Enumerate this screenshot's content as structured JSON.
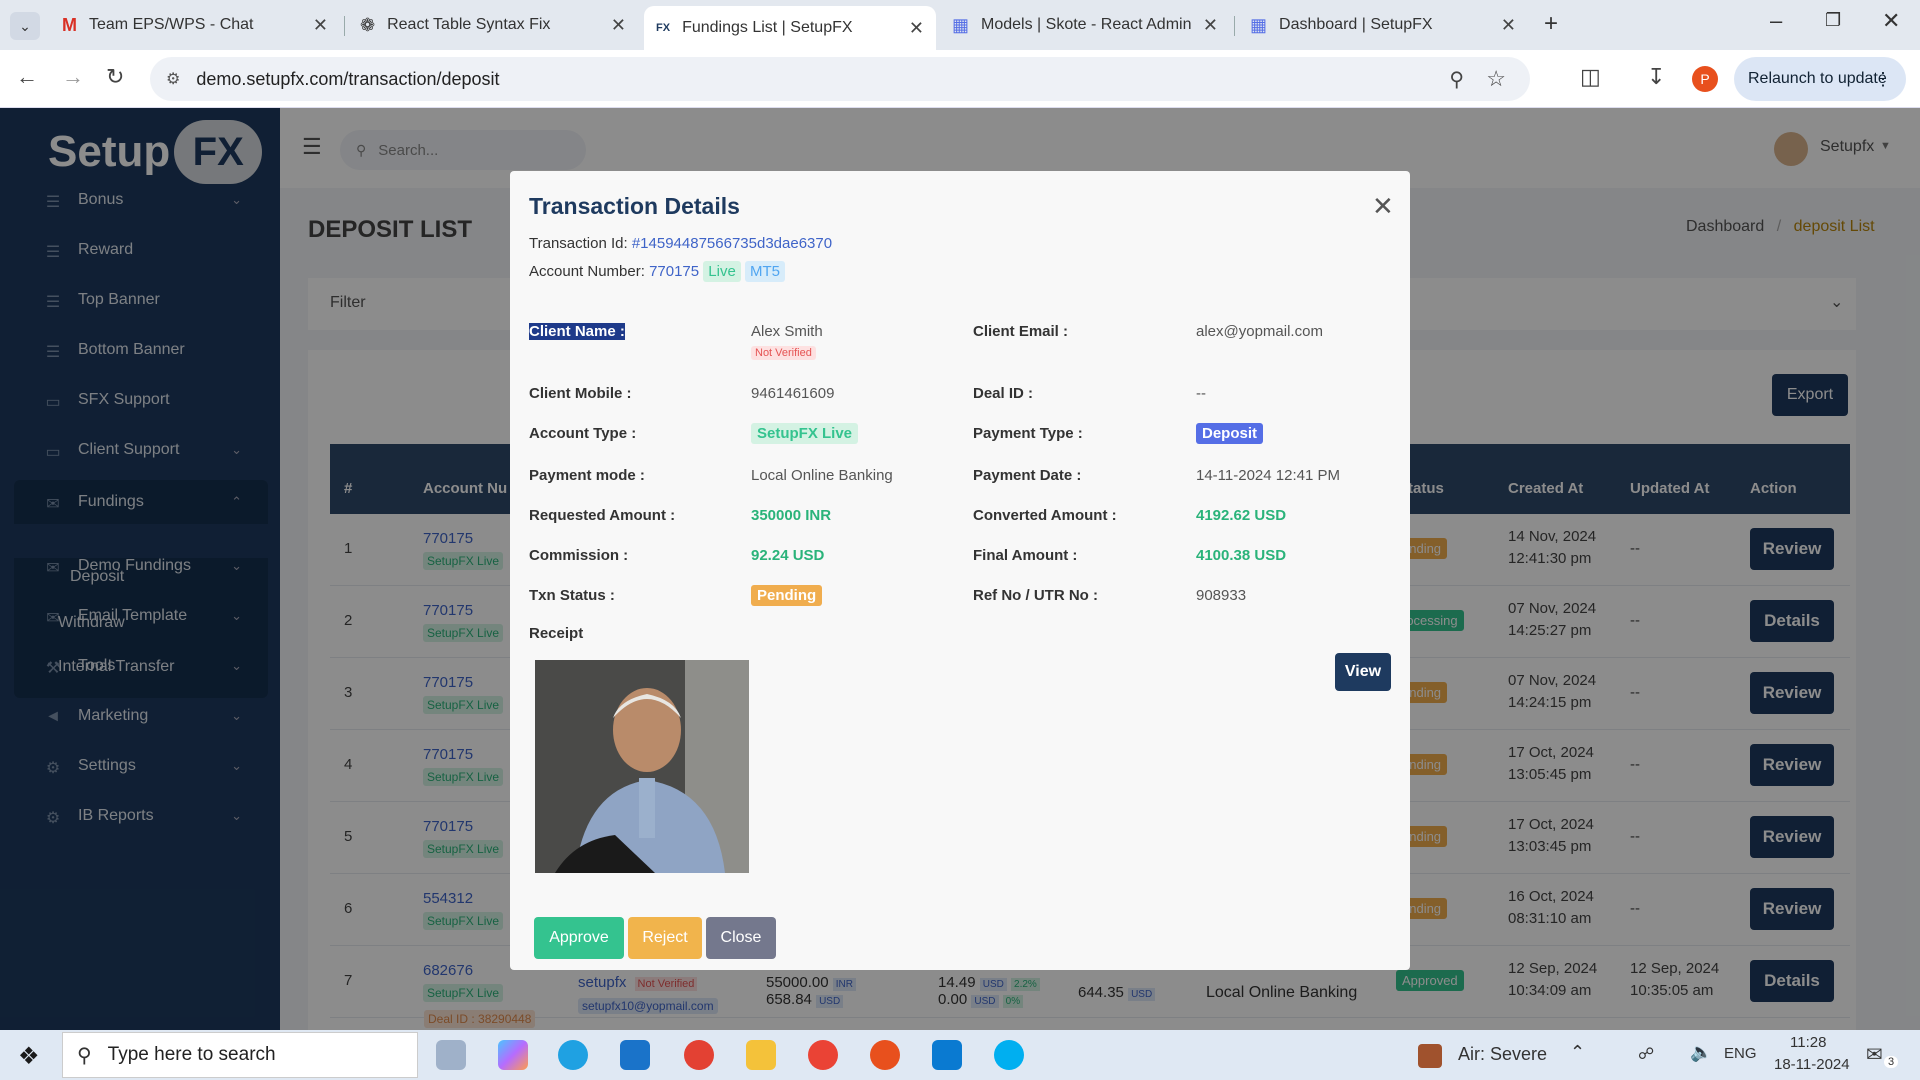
{
  "browser": {
    "tabs": [
      {
        "title": "Team EPS/WPS - Chat",
        "icon": "gmail-icon"
      },
      {
        "title": "React Table Syntax Fix",
        "icon": "chatgpt-icon"
      },
      {
        "title": "Fundings List | SetupFX",
        "icon": "setupfx-icon",
        "active": true
      },
      {
        "title": "Models | Skote - React Admin &",
        "icon": "skote-icon"
      },
      {
        "title": "Dashboard | SetupFX",
        "icon": "skote-icon"
      }
    ],
    "url": "demo.setupfx.com/transaction/deposit",
    "relaunch": "Relaunch to update",
    "profile_initial": "P"
  },
  "sidebar": {
    "logo_text": "Setup",
    "logo_fx": "FX",
    "items": [
      {
        "label": "Bonus",
        "icon": "list-icon",
        "chevron": true
      },
      {
        "label": "Reward",
        "icon": "list-icon",
        "chevron": false
      },
      {
        "label": "Top Banner",
        "icon": "list-icon",
        "chevron": false
      },
      {
        "label": "Bottom Banner",
        "icon": "list-icon",
        "chevron": false
      },
      {
        "label": "SFX Support",
        "icon": "monitor-icon",
        "chevron": false
      },
      {
        "label": "Client Support",
        "icon": "monitor-icon",
        "chevron": true
      },
      {
        "label": "Fundings",
        "icon": "mail-icon",
        "chevron": true
      },
      {
        "label": "Demo Fundings",
        "icon": "mail-icon",
        "chevron": true
      },
      {
        "label": "Email Template",
        "icon": "mail-icon",
        "chevron": true
      },
      {
        "label": "Tools",
        "icon": "wrench-icon",
        "chevron": true
      },
      {
        "label": "Marketing",
        "icon": "megaphone-icon",
        "chevron": true
      },
      {
        "label": "Settings",
        "icon": "gear-icon",
        "chevron": true
      },
      {
        "label": "IB Reports",
        "icon": "gear-icon",
        "chevron": true
      }
    ],
    "sub_items": [
      "Deposit",
      "Withdraw",
      "Internal Transfer"
    ]
  },
  "topbar": {
    "search_placeholder": "Search...",
    "user": "Setupfx"
  },
  "page": {
    "title": "DEPOSIT LIST",
    "breadcrumb_home": "Dashboard",
    "breadcrumb_sep": "/",
    "breadcrumb_current": "deposit List",
    "filter_label": "Filter",
    "export_label": "Export"
  },
  "table": {
    "headers": [
      "#",
      "Account Nu",
      "tatus",
      "Created At",
      "Updated At",
      "Action"
    ],
    "rows": [
      {
        "n": "1",
        "acc": "770175",
        "badge": "SetupFX Live",
        "status": "ending",
        "status_color": "#f0ad4e",
        "created": "14 Nov, 2024",
        "created_time": "12:41:30 pm",
        "updated": "--",
        "updated_time": "",
        "action": "Review"
      },
      {
        "n": "2",
        "acc": "770175",
        "badge": "SetupFX Live",
        "status": "rocessing",
        "status_color": "#34c38f",
        "created": "07 Nov, 2024",
        "created_time": "14:25:27 pm",
        "updated": "--",
        "updated_time": "",
        "action": "Details"
      },
      {
        "n": "3",
        "acc": "770175",
        "badge": "SetupFX Live",
        "status": "ending",
        "status_color": "#f0ad4e",
        "created": "07 Nov, 2024",
        "created_time": "14:24:15 pm",
        "updated": "--",
        "updated_time": "",
        "action": "Review"
      },
      {
        "n": "4",
        "acc": "770175",
        "badge": "SetupFX Live",
        "status": "ending",
        "status_color": "#f0ad4e",
        "created": "17 Oct, 2024",
        "created_time": "13:05:45 pm",
        "updated": "--",
        "updated_time": "",
        "action": "Review"
      },
      {
        "n": "5",
        "acc": "770175",
        "badge": "SetupFX Live",
        "status": "ending",
        "status_color": "#f0ad4e",
        "created": "17 Oct, 2024",
        "created_time": "13:03:45 pm",
        "updated": "--",
        "updated_time": "",
        "action": "Review"
      },
      {
        "n": "6",
        "acc": "554312",
        "badge": "SetupFX Live",
        "status": "ending",
        "status_color": "#f0ad4e",
        "created": "16 Oct, 2024",
        "created_time": "08:31:10 am",
        "updated": "--",
        "updated_time": "",
        "action": "Review"
      },
      {
        "n": "7",
        "acc": "682676",
        "badge": "SetupFX Live",
        "status": "Approved",
        "status_color": "#34c38f",
        "created": "12 Sep, 2024",
        "created_time": "10:34:09 am",
        "updated": "12 Sep, 2024",
        "updated_time": "10:35:05 am",
        "action": "Details"
      }
    ],
    "row7_extra": {
      "deal": "Deal ID : 38290448",
      "client": "setupfx",
      "not_verified": "Not Verified",
      "email": "setupfx10@yopmail.com",
      "amt1": "55000.00",
      "cur1": "INR",
      "amt2": "658.84",
      "cur2": "USD",
      "comm1": "14.49",
      "comm1_cur": "USD",
      "comm1_pct": "2.2%",
      "comm2": "0.00",
      "comm2_cur": "USD",
      "comm2_pct": "0%",
      "final": "644.35",
      "final_cur": "USD",
      "mode": "Local Online Banking"
    }
  },
  "modal": {
    "title": "Transaction Details",
    "txn_label": "Transaction Id:",
    "txn_id": "#14594487566735d3dae6370",
    "acc_label": "Account Number:",
    "acc_number": "770175",
    "acc_badge1": "Live",
    "acc_badge2": "MT5",
    "client_name_label": "Client Name :",
    "client_name": "Alex Smith",
    "not_verified": "Not Verified",
    "client_email_label": "Client Email :",
    "client_email": "alex@yopmail.com",
    "client_mobile_label": "Client Mobile :",
    "client_mobile": "9461461609",
    "deal_id_label": "Deal ID :",
    "deal_id": "--",
    "account_type_label": "Account Type :",
    "account_type": "SetupFX Live",
    "payment_type_label": "Payment Type :",
    "payment_type": "Deposit",
    "payment_mode_label": "Payment mode :",
    "payment_mode": "Local Online Banking",
    "payment_date_label": "Payment Date :",
    "payment_date": "14-11-2024 12:41 PM",
    "requested_label": "Requested Amount :",
    "requested": "350000 INR",
    "converted_label": "Converted Amount :",
    "converted": "4192.62 USD",
    "commission_label": "Commission :",
    "commission": "92.24 USD",
    "final_label": "Final Amount :",
    "final": "4100.38 USD",
    "txn_status_label": "Txn Status :",
    "txn_status": "Pending",
    "ref_label": "Ref No / UTR No :",
    "ref": "908933",
    "receipt_label": "Receipt",
    "view_label": "View",
    "approve_label": "Approve",
    "reject_label": "Reject",
    "close_label": "Close"
  },
  "taskbar": {
    "search_placeholder": "Type here to search",
    "weather": "Air: Severe",
    "lang": "ENG",
    "time": "11:28",
    "date": "18-11-2024",
    "notif_count": "3"
  },
  "colors": {
    "sidebar": "#1e3a5f",
    "accent_green": "#34c38f",
    "accent_orange": "#f0ad4e",
    "link": "#3f64c8",
    "deposit_badge": "#556ee6"
  }
}
